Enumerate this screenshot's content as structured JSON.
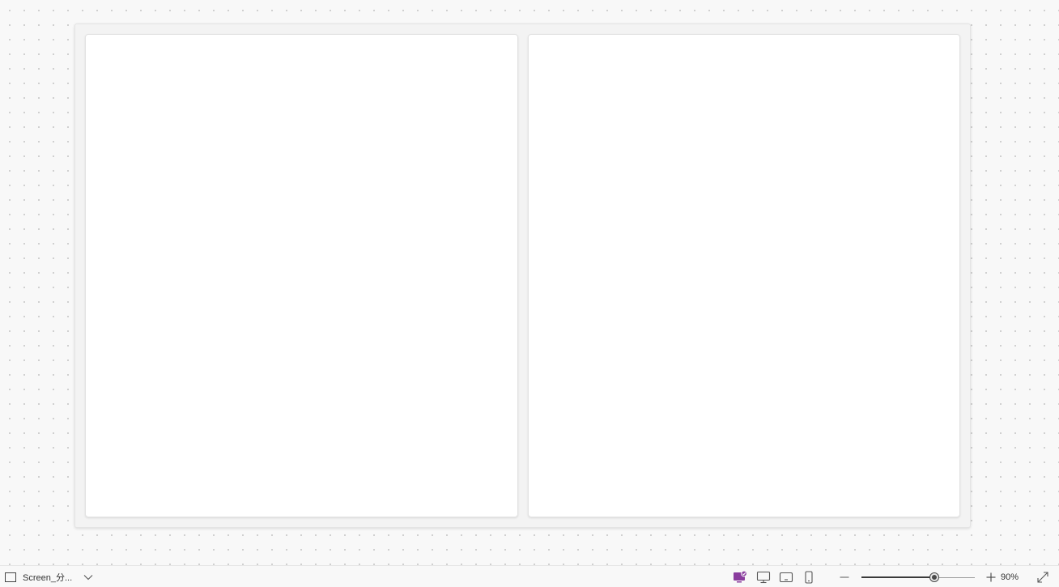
{
  "canvas": {
    "panels": [
      "left-panel",
      "right-panel"
    ]
  },
  "statusbar": {
    "screen_name": "Screen_分...",
    "screen_icon": "screen-rectangle-icon",
    "dropdown_icon": "chevron-down-icon",
    "view_buttons": [
      {
        "name": "custom-layout-icon",
        "active": true
      },
      {
        "name": "desktop-icon",
        "active": false
      },
      {
        "name": "tablet-icon",
        "active": false
      },
      {
        "name": "phone-icon",
        "active": false
      }
    ],
    "zoom_out_icon": "minus-icon",
    "zoom_in_icon": "plus-icon",
    "zoom_level": 0.9,
    "zoom_label": "90%",
    "fit_icon": "expand-diagonal-icon",
    "accent_color": "#8a3d9e"
  }
}
